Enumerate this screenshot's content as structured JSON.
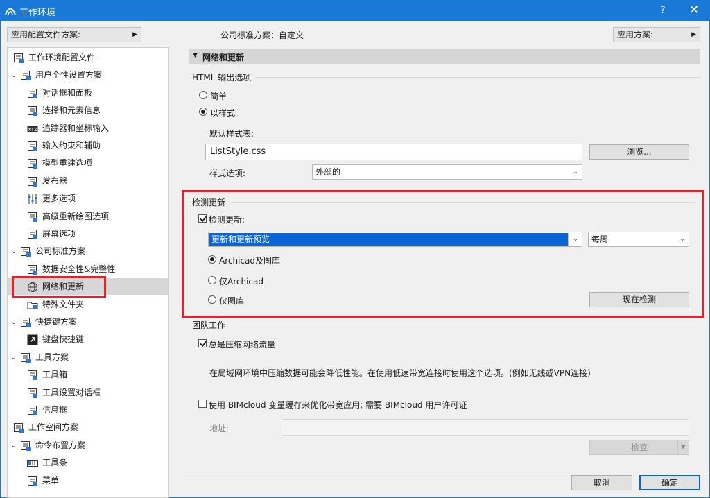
{
  "window": {
    "title": "工作环境",
    "help": "?",
    "close": "✕"
  },
  "top": {
    "apply_profile": "应用配置文件方案:",
    "company_standard": "公司标准方案：自定义",
    "apply_scheme": "应用方案:"
  },
  "tree": [
    {
      "label": "工作环境配置文件",
      "icon": "profile-icon",
      "chev": "",
      "level": 0
    },
    {
      "label": "用户个性设置方案",
      "icon": "user-scheme-icon",
      "chev": "⌄",
      "level": 0
    },
    {
      "label": "对话框和面板",
      "icon": "dialog-icon",
      "chev": "",
      "level": 1
    },
    {
      "label": "选择和元素信息",
      "icon": "selection-icon",
      "chev": "",
      "level": 1
    },
    {
      "label": "追踪器和坐标输入",
      "icon": "xyz-icon",
      "chev": "",
      "level": 1
    },
    {
      "label": "输入约束和辅助",
      "icon": "mouse-icon",
      "chev": "",
      "level": 1
    },
    {
      "label": "模型重建选项",
      "icon": "model-icon",
      "chev": "",
      "level": 1
    },
    {
      "label": "发布器",
      "icon": "publisher-icon",
      "chev": "",
      "level": 1
    },
    {
      "label": "更多选项",
      "icon": "sliders-icon",
      "chev": "",
      "level": 1
    },
    {
      "label": "高级重新绘图选项",
      "icon": "redraw-icon",
      "chev": "",
      "level": 1
    },
    {
      "label": "屏幕选项",
      "icon": "screen-icon",
      "chev": "",
      "level": 1
    },
    {
      "label": "公司标准方案",
      "icon": "company-scheme-icon",
      "chev": "⌄",
      "level": 0
    },
    {
      "label": "数据安全性&完整性",
      "icon": "data-safety-icon",
      "chev": "",
      "level": 1
    },
    {
      "label": "网络和更新",
      "icon": "globe-icon",
      "chev": "",
      "level": 1,
      "selected": true
    },
    {
      "label": "特殊文件夹",
      "icon": "folder-icon",
      "chev": "",
      "level": 1
    },
    {
      "label": "快捷键方案",
      "icon": "shortcut-scheme-icon",
      "chev": "⌄",
      "level": 0
    },
    {
      "label": "键盘快捷键",
      "icon": "keyboard-shortcut-icon",
      "chev": "",
      "level": 1
    },
    {
      "label": "工具方案",
      "icon": "tool-scheme-icon",
      "chev": "⌄",
      "level": 0
    },
    {
      "label": "工具箱",
      "icon": "toolbox-icon",
      "chev": "",
      "level": 1
    },
    {
      "label": "工具设置对话框",
      "icon": "tool-settings-icon",
      "chev": "",
      "level": 1
    },
    {
      "label": "信息框",
      "icon": "info-box-icon",
      "chev": "",
      "level": 1
    },
    {
      "label": "工作空间方案",
      "icon": "workspace-scheme-icon",
      "chev": "",
      "level": 0
    },
    {
      "label": "命令布置方案",
      "icon": "command-scheme-icon",
      "chev": "⌄",
      "level": 0
    },
    {
      "label": "工具条",
      "icon": "toolbar-icon",
      "chev": "",
      "level": 1
    },
    {
      "label": "菜单",
      "icon": "menu-icon",
      "chev": "",
      "level": 1
    }
  ],
  "panel": {
    "section_title": "网络和更新",
    "html": {
      "title": "HTML 输出选项",
      "simple": "简单",
      "styled": "以样式",
      "default_stylesheet_label": "默认样式表:",
      "stylesheet_value": "ListStyle.css",
      "browse": "浏览...",
      "style_options_label": "样式选项:",
      "style_options_value": "外部的"
    },
    "update": {
      "title": "检测更新",
      "check_label": "检测更新:",
      "update_type": "更新和更新预览",
      "frequency": "每周",
      "opt_both": "Archicad及图库",
      "opt_archicad": "仅Archicad",
      "opt_library": "仅图库",
      "check_now": "现在检测"
    },
    "team": {
      "title": "团队工作",
      "compress": "总是压缩网络流量",
      "note": "在局域网环境中压缩数据可能会降低性能。在使用低速带宽连接时使用这个选项。(例如无线或VPN连接)",
      "bimcloud": "使用 BIMcloud 变量缓存来优化带宽应用; 需要 BIMcloud 用户许可证",
      "address_label": "地址:",
      "check": "检查"
    }
  },
  "footer": {
    "cancel": "取消",
    "ok": "确定"
  },
  "colors": {
    "title_bar": "#1a78d6",
    "highlight": "#e8202a",
    "selection": "#0a64d6"
  }
}
